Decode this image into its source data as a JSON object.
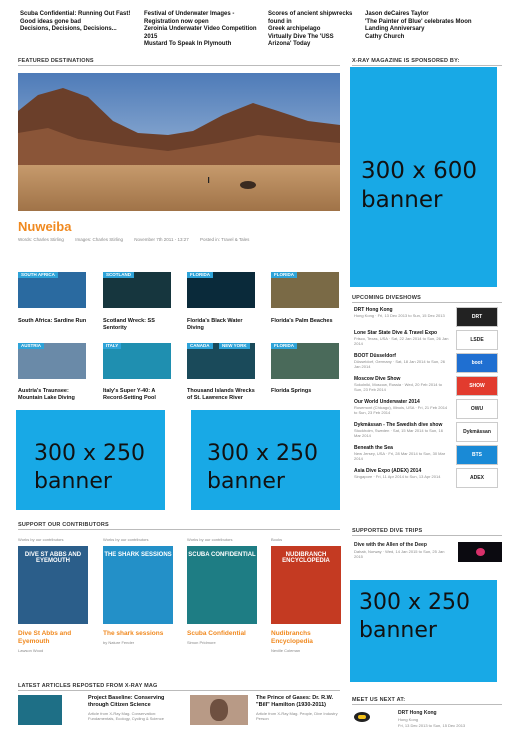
{
  "top_news": [
    [
      "Scuba Confidential: Running Out Fast!",
      "Good ideas gone bad",
      "Decisions, Decisions, Decisions..."
    ],
    [
      "Festival of Underwater Images -",
      "Registration now open",
      "Zeroinia Underwater Video Competition",
      "2015",
      "Mustard To Speak In Plymouth"
    ],
    [
      "Scores of ancient shipwrecks found in",
      "Greek archipelago",
      "Virtually Dive The 'USS Arizona' Today"
    ],
    [
      "Jason deCaires Taylor",
      "'The Painter of Blue' celebrates Moon",
      "Landing Anniversary",
      "Cathy Church"
    ]
  ],
  "sections": {
    "featured": "FEATURED DESTINATIONS",
    "sponsored": "X-RAY MAGAZINE IS SPONSORED BY:",
    "upcoming": "UPCOMING DIVESHOWS",
    "support": "SUPPORT OUR CONTRIBUTORS",
    "dive_trips": "SUPPORTED DIVE TRIPS",
    "latest": "LATEST ARTICLES REPOSTED FROM X-RAY MAG",
    "meet": "MEET US NEXT AT:"
  },
  "featured": {
    "title": "Nuweiba",
    "meta": [
      "Words: Charles Stirling",
      "Images: Charles Stirling",
      "November 7th 2011 - 13:27",
      "Posted in: Travel & Tales"
    ]
  },
  "colors": {
    "banner": "#18a9e6",
    "orange": "#f0891f"
  },
  "destinations": [
    {
      "tag": "SOUTH AFRICA",
      "tag_color": "#2ea3d8",
      "caption": "South Africa: Sardine Run",
      "img": "#2a6aa0"
    },
    {
      "tag": "SCOTLAND",
      "tag_color": "#2ea3d8",
      "caption": "Scotland Wreck: SS Sentority",
      "img": "#16363e"
    },
    {
      "tag": "FLORIDA",
      "tag_color": "#2ea3d8",
      "caption": "Florida's Black Water Diving",
      "img": "#0a2a3a"
    },
    {
      "tag": "FLORIDA",
      "tag_color": "#2ea3d8",
      "caption": "Florida's Palm Beaches",
      "img": "#7a6a46"
    },
    {
      "tag": "AUSTRIA",
      "tag_color": "#2ea3d8",
      "caption": "Austria's Traunsee: Mountain Lake Diving",
      "img": "#6a8aa8"
    },
    {
      "tag": "ITALY",
      "tag_color": "#2ea3d8",
      "caption": "Italy's Super Y-40: A Record-Setting Pool",
      "img": "#1f8fb0"
    },
    {
      "tag": "CANADA",
      "tag2": "NEW YORK",
      "tag_color": "#2ea3d8",
      "caption": "Thousand Islands Wrecks of St. Lawrence River",
      "img": "#1a4a5a"
    },
    {
      "tag": "FLORIDA",
      "tag_color": "#2ea3d8",
      "caption": "Florida Springs",
      "img": "#4a6a5a"
    }
  ],
  "banners": {
    "right_top": [
      "300 x 600",
      "banner"
    ],
    "mid_left": [
      "300 x 250",
      "banner"
    ],
    "mid_center": [
      "300 x 250",
      "banner"
    ],
    "right_bottom": [
      "300 x 250",
      "banner"
    ]
  },
  "diveshows": [
    {
      "title": "DRT Hong Kong",
      "date": "Hong Kong · Fri, 13 Dec 2013 to Sun, 15 Dec 2013"
    },
    {
      "title": "Lone Star State Dive & Travel Expo",
      "date": "Frisco, Texas, USA · Sat, 22 Jan 2014 to Sun, 26 Jan 2014"
    },
    {
      "title": "BOOT Düsseldorf",
      "date": "Düsseldorf, Germany · Sat, 18 Jan 2014 to Sun, 26 Jan 2014"
    },
    {
      "title": "Moscow Dive Show",
      "date": "Sokolniki, Moscow, Russia · Wed, 20 Feb 2014 to Sun, 23 Feb 2014"
    },
    {
      "title": "Our World Underwater 2014",
      "date": "Rosemont (Chicago), Illinois, USA · Fri, 21 Feb 2014 to Sun, 23 Feb 2014"
    },
    {
      "title": "Dykmässan - The Swedish dive show",
      "date": "Stockholm, Sweden · Sat, 15 Mar 2014 to Sun, 16 Mar 2014"
    },
    {
      "title": "Beneath the Sea",
      "date": "New Jersey, USA · Fri, 28 Mar 2014 to Sun, 30 Mar 2014"
    },
    {
      "title": "Asia Dive Expo (ADEX) 2014",
      "date": "Singapore · Fri, 11 Apr 2014 to Sun, 13 Apr 2014"
    }
  ],
  "show_logos": [
    "DRT",
    "LSDE",
    "boot",
    "SHOW",
    "OWU",
    "Dykmässan",
    "BTS",
    "ADEX"
  ],
  "contributors": [
    {
      "head": "Works by our contributors",
      "cover": "#2b5e8a",
      "cover_text": "DIVE ST ABBS AND EYEMOUTH",
      "title": "Dive St Abbs and Eyemouth",
      "author": "Lawson Wood"
    },
    {
      "head": "Works by our contributors",
      "cover": "#2390c8",
      "cover_text": "THE SHARK SESSIONS",
      "title": "The shark sessions",
      "author": "by Nature Fender"
    },
    {
      "head": "Works by our contributors",
      "cover": "#1e7d84",
      "cover_text": "SCUBA CONFIDENTIAL",
      "title": "Scuba Confidential",
      "author": "Simon Pridmore"
    },
    {
      "head": "Books",
      "cover": "#c43a22",
      "cover_text": "NUDIBRANCH ENCYCLOPEDIA",
      "title": "Nudibranchs Encyclopedia",
      "author": "Neville Coleman"
    }
  ],
  "dive_trip": {
    "title": "Dive with the Allen of the Deep",
    "date": "Dahab, Norway · Wed, 14 Jan 2015 to Sun, 25 Jan 2015"
  },
  "latest_articles": [
    {
      "title": "Project Baseline: Conserving through Citizen Science",
      "note": "Article from X-Ray Mag. Conservation: Fundamentals, Ecology, Cycling & Science"
    },
    {
      "title": "The Prince of Gases: Dr. R.W. \"Bill\" Hamilton (1930-2011)",
      "note": "Article from X-Ray Mag. People, Dive Industry Person"
    }
  ],
  "meet": {
    "title": "DRT Hong Kong",
    "place": "Hong Kong",
    "date": "Fri, 13 Dec 2013 to Sun, 15 Dec 2013"
  }
}
